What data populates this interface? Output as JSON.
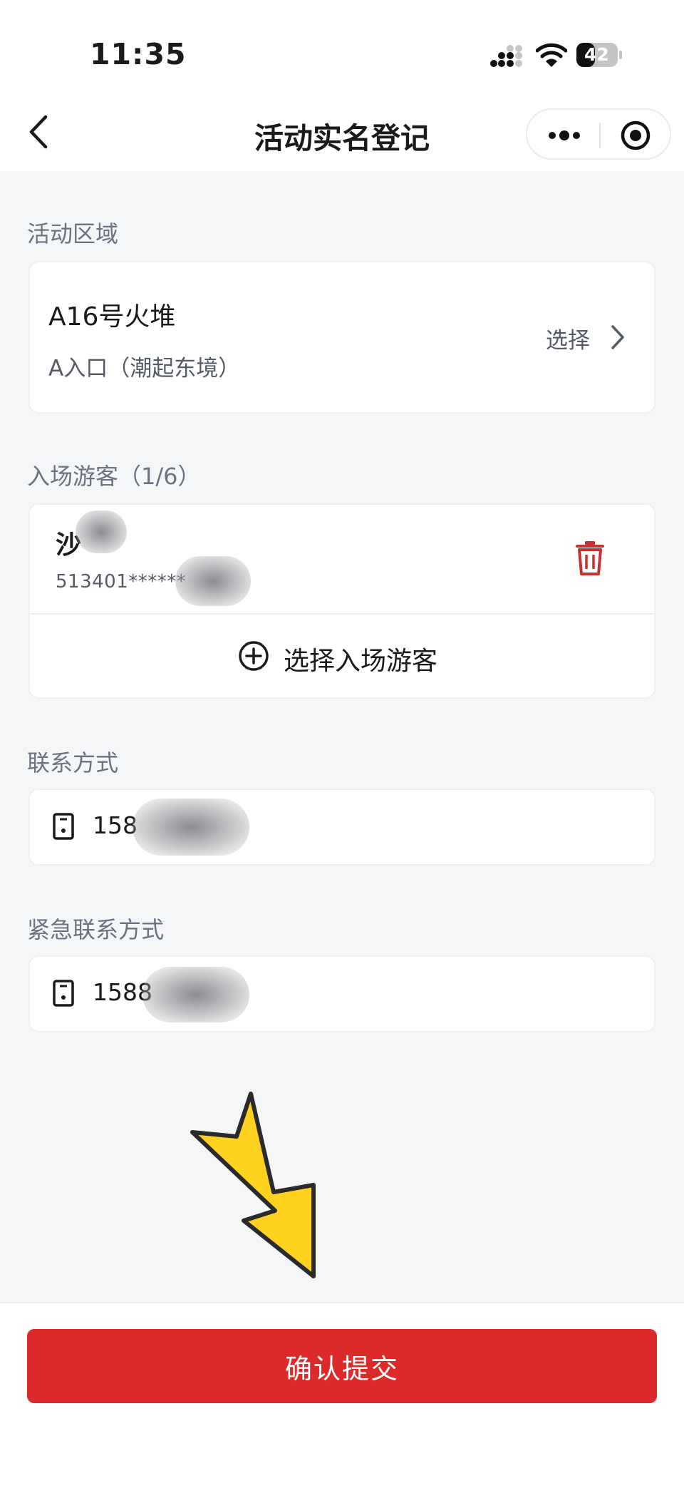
{
  "status_bar": {
    "time": "11:35",
    "battery": "42"
  },
  "nav": {
    "title": "活动实名登记"
  },
  "area": {
    "label": "活动区域",
    "name": "A16号火堆",
    "entrance": "A入口（潮起东境）",
    "select_label": "选择"
  },
  "guests": {
    "label": "入场游客（1/6）",
    "items": [
      {
        "name": "沙",
        "id": "513401******"
      }
    ],
    "add_label": "选择入场游客"
  },
  "contact": {
    "label": "联系方式",
    "phone": "158"
  },
  "emergency": {
    "label": "紧急联系方式",
    "phone": "1588"
  },
  "submit": {
    "label": "确认提交"
  },
  "colors": {
    "accent": "#dc2a2a",
    "arrow": "#ffd21f"
  }
}
